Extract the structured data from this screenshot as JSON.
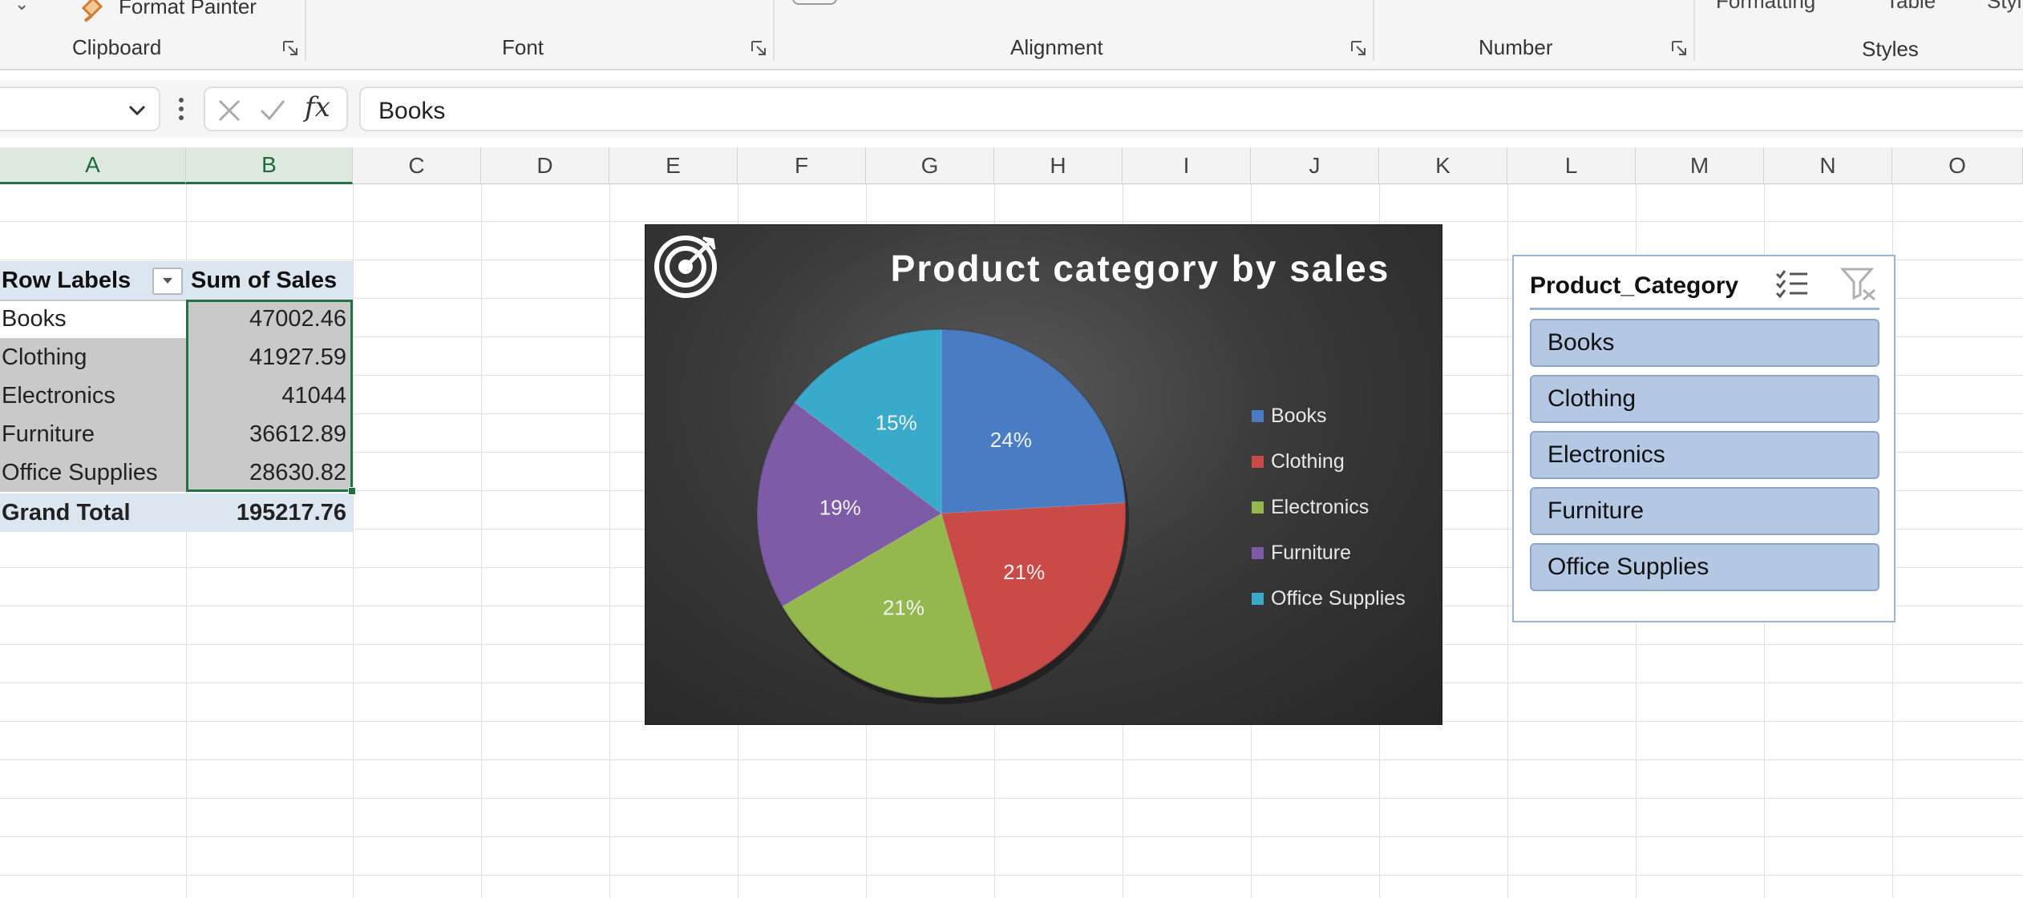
{
  "ribbon": {
    "format_painter": "Format Painter",
    "groups": {
      "clipboard": "Clipboard",
      "font": "Font",
      "alignment": "Alignment",
      "number": "Number",
      "styles": "Styles"
    },
    "cut_style_items": [
      "Formatting",
      "Table",
      "Styl"
    ]
  },
  "formula_bar": {
    "name_box": "",
    "fx_label": "fx",
    "formula": "Books"
  },
  "columns": [
    "A",
    "B",
    "C",
    "D",
    "E",
    "F",
    "G",
    "H",
    "I",
    "J",
    "K",
    "L",
    "M",
    "N",
    "O"
  ],
  "pivot": {
    "header_labels": "Row Labels",
    "header_values": "Sum of Sales",
    "rows": [
      {
        "label": "Books",
        "value": "47002.46"
      },
      {
        "label": "Clothing",
        "value": "41927.59"
      },
      {
        "label": "Electronics",
        "value": "41044"
      },
      {
        "label": "Furniture",
        "value": "36612.89"
      },
      {
        "label": "Office Supplies",
        "value": "28630.82"
      }
    ],
    "total_label": "Grand Total",
    "total_value": "195217.76"
  },
  "chart_data": {
    "type": "pie",
    "title": "Product category by sales",
    "categories": [
      "Books",
      "Clothing",
      "Electronics",
      "Furniture",
      "Office Supplies"
    ],
    "values": [
      47002.46,
      41927.59,
      41044,
      36612.89,
      28630.82
    ],
    "data_labels": [
      "24%",
      "21%",
      "21%",
      "19%",
      "15%"
    ],
    "colors": [
      "#4a7cc4",
      "#c94a47",
      "#94b84e",
      "#7d5ba6",
      "#3aaacb"
    ],
    "legend_position": "right",
    "background": "dark"
  },
  "slicer": {
    "title": "Product_Category",
    "items": [
      "Books",
      "Clothing",
      "Electronics",
      "Furniture",
      "Office Supplies"
    ],
    "multi_select_icon": "multi-select-icon",
    "clear_filter_icon": "clear-filter-icon"
  }
}
